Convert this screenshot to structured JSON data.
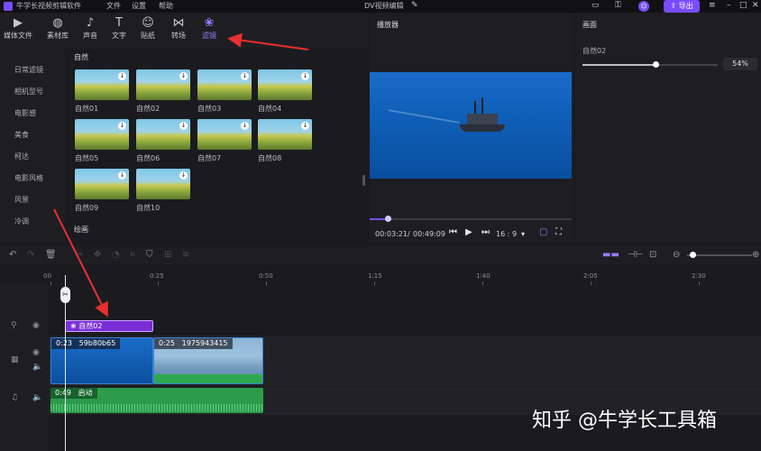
{
  "titlebar": {
    "app_name": "牛学长视频剪辑软件",
    "menu": [
      "文件",
      "设置",
      "帮助"
    ],
    "project_title": "DV视频编辑",
    "export_label": "导出"
  },
  "toolbar": {
    "items": [
      {
        "label": "媒体文件",
        "icon": "media-icon"
      },
      {
        "label": "素材库",
        "icon": "library-icon"
      },
      {
        "label": "声音",
        "icon": "music-note-icon"
      },
      {
        "label": "文字",
        "icon": "text-icon"
      },
      {
        "label": "贴纸",
        "icon": "sticker-icon"
      },
      {
        "label": "转场",
        "icon": "transition-icon"
      },
      {
        "label": "滤镜",
        "icon": "filter-icon"
      }
    ],
    "active": "滤镜"
  },
  "categories": [
    "日常滤镜",
    "相机型号",
    "电影感",
    "美食",
    "柯达",
    "电影风格",
    "风景",
    "冷调"
  ],
  "effects": {
    "section_title": "自然",
    "items": [
      "自然01",
      "自然02",
      "自然03",
      "自然04",
      "自然05",
      "自然06",
      "自然07",
      "自然08",
      "自然09",
      "自然10"
    ],
    "next_section": "绘画"
  },
  "player": {
    "header": "播放器",
    "current_time": "00:03:21",
    "separator": "/",
    "total_time": "00:49:09",
    "aspect": "16 : 9",
    "progress": 0.09
  },
  "properties": {
    "header": "画面",
    "filter_name": "自然02",
    "intensity_value": "54%",
    "intensity": 0.54
  },
  "timeline": {
    "ruler": [
      "00",
      "0:25",
      "0:50",
      "1:15",
      "1:40",
      "2:05",
      "2:30"
    ],
    "filter_clip_label": "自然02",
    "video_clips": [
      {
        "duration": "0:23",
        "name": "59b80b65"
      },
      {
        "duration": "0:25",
        "name": "1975943415"
      }
    ],
    "audio_clip": {
      "duration": "0:49",
      "name": "启动"
    }
  },
  "watermark": "知乎 @牛学长工具箱"
}
